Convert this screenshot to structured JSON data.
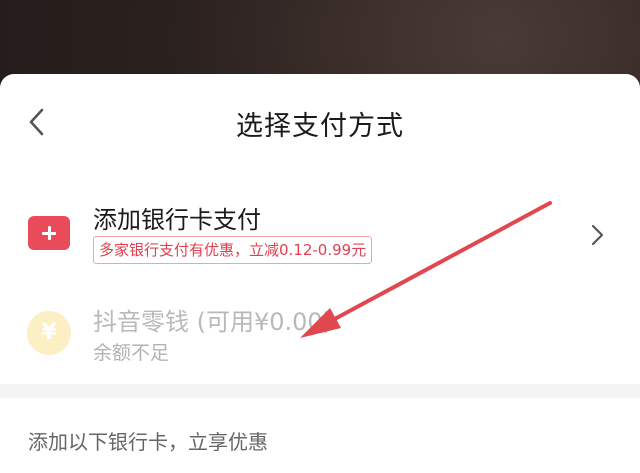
{
  "header": {
    "title": "选择支付方式",
    "back_icon": "chevron-left-icon"
  },
  "payment_methods": {
    "add_bank_card": {
      "icon": "plus-icon",
      "label": "添加银行卡支付",
      "promo": "多家银行支付有优惠，立减0.12-0.99元",
      "arrow_icon": "chevron-right-icon"
    },
    "wallet": {
      "icon": "yuan-icon",
      "icon_glyph": "¥",
      "label": "抖音零钱 (可用¥0.00)",
      "subtitle": "余额不足",
      "disabled": true
    }
  },
  "bank_section": {
    "label": "添加以下银行卡，立享优惠"
  },
  "colors": {
    "accent_red": "#e94b5a",
    "annotation_arrow": "#e0474f",
    "yuan_icon_bg": "#fcefc4"
  }
}
